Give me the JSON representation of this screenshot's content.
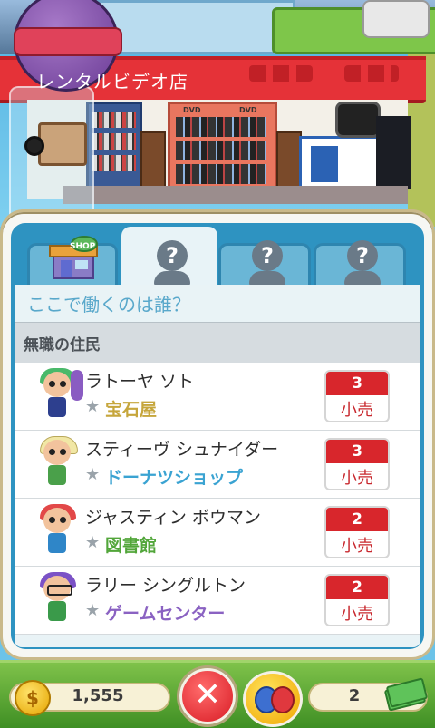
{
  "scene": {
    "store_sign": "レンタルビデオ店",
    "dvd_label": "DVD"
  },
  "tabs": [
    {
      "label": "SHOP",
      "type": "shop",
      "active": false
    },
    {
      "label": "?",
      "type": "unknown",
      "active": true
    },
    {
      "label": "?",
      "type": "unknown",
      "active": false
    },
    {
      "label": "?",
      "type": "unknown",
      "active": false
    }
  ],
  "panel": {
    "question": "ここで働くのは誰？",
    "section_title": "無職の住民"
  },
  "residents": [
    {
      "name": "ラトーヤ ソト",
      "job": "宝石屋",
      "job_color": "#c6a63c",
      "skill": "3",
      "skill_label": "小売"
    },
    {
      "name": "スティーヴ シュナイダー",
      "job": "ドーナツショップ",
      "job_color": "#3aa3d2",
      "skill": "3",
      "skill_label": "小売"
    },
    {
      "name": "ジャスティン ボウマン",
      "job": "図書館",
      "job_color": "#52a63a",
      "skill": "2",
      "skill_label": "小売"
    },
    {
      "name": "ラリー シングルトン",
      "job": "ゲームセンター",
      "job_color": "#8a62c2",
      "skill": "2",
      "skill_label": "小売"
    }
  ],
  "footer": {
    "coins": "1,555",
    "coin_icon": "coin-icon",
    "bux": "2",
    "bux_icon": "bux-bill-icon",
    "close_icon": "close-icon",
    "social_icon": "friends-icon"
  }
}
